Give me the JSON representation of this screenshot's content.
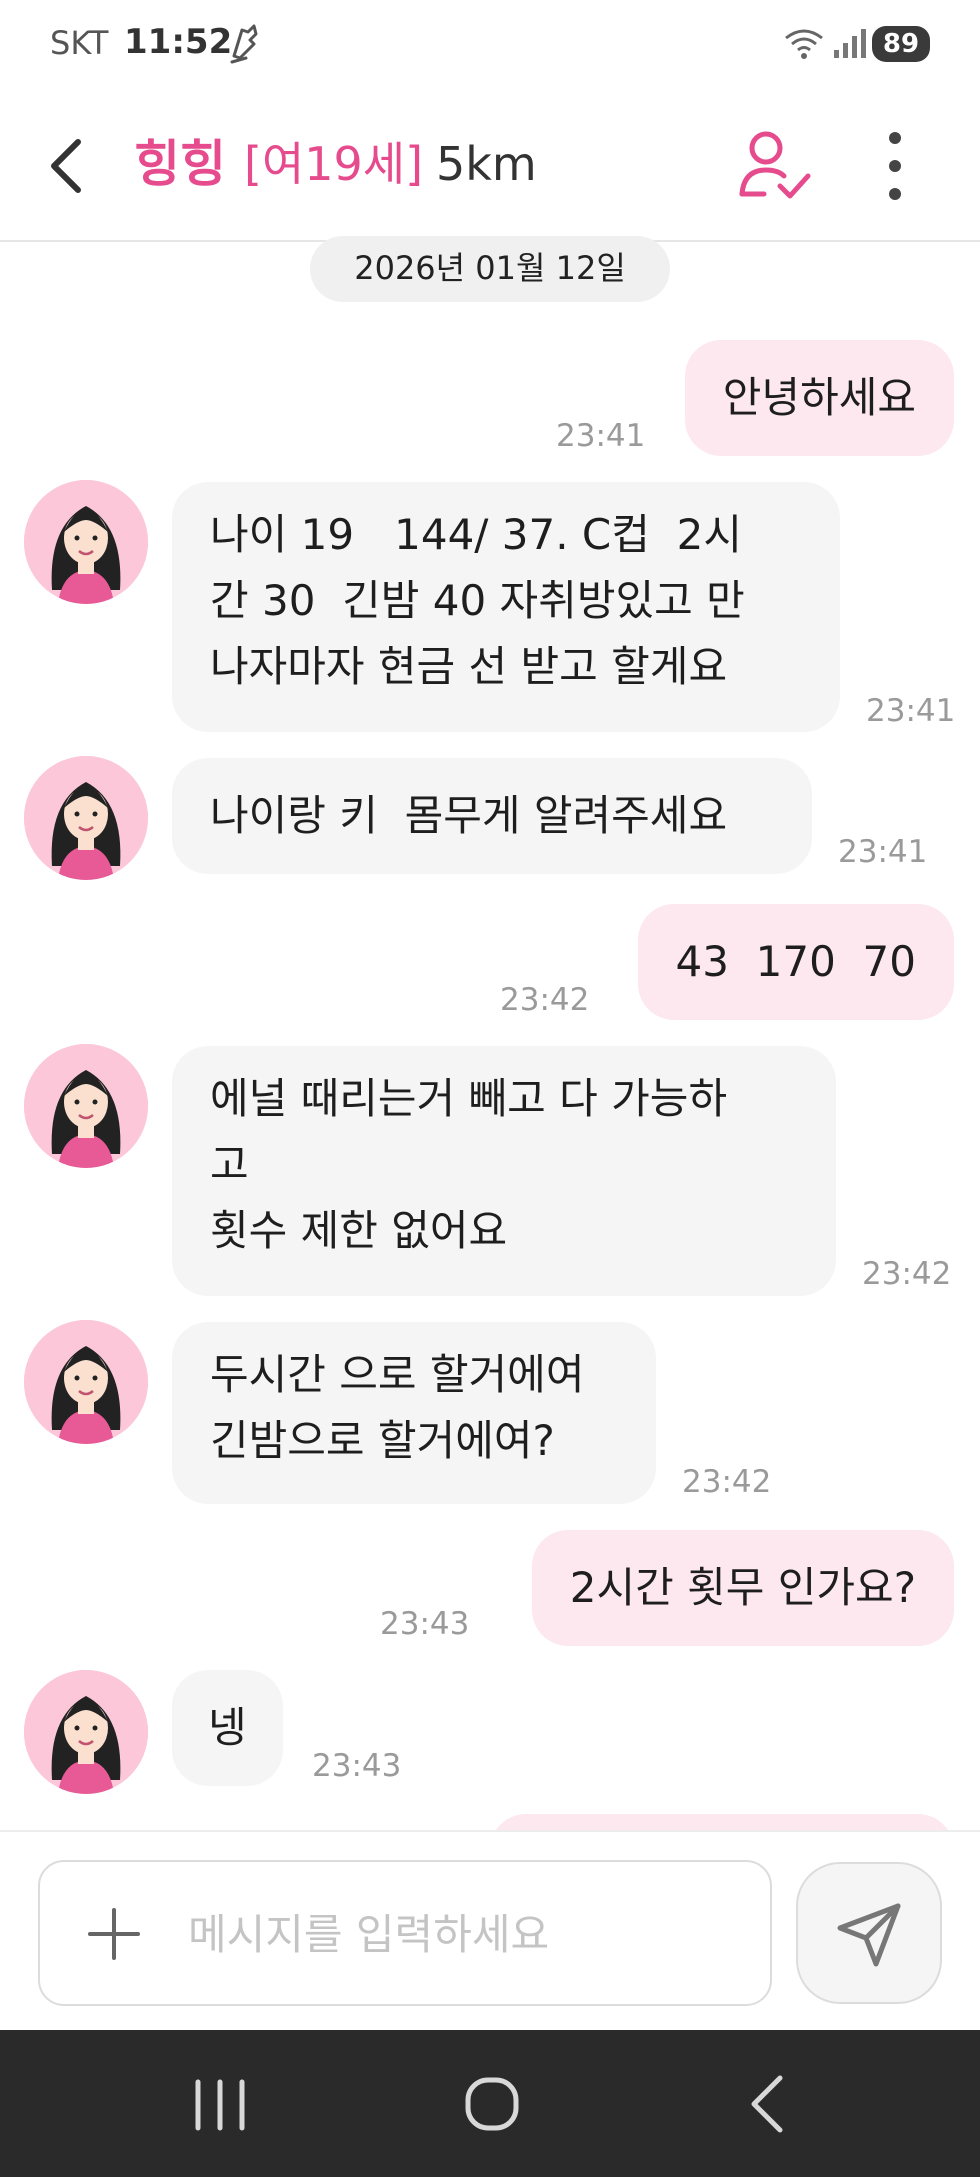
{
  "status_bar": {
    "carrier": "SKT",
    "time": "11:52",
    "battery": "89"
  },
  "header": {
    "name": "힝힝",
    "meta": "[여19세]",
    "distance": "5km"
  },
  "date_label": "2026년 01월 12일",
  "messages": [
    {
      "dir": "out",
      "text": "안녕하세요",
      "time": "23:41"
    },
    {
      "dir": "in",
      "text": "나이 19   144/ 37. C컵  2시\n간 30  긴밤 40 자취방있고 만\n나자마자 현금 선 받고 할게요",
      "time": "23:41"
    },
    {
      "dir": "in",
      "text": "나이랑 키  몸무게 알려주세요",
      "time": "23:41"
    },
    {
      "dir": "out",
      "text": "43  170  70",
      "time": "23:42"
    },
    {
      "dir": "in",
      "text": "에널 때리는거 빼고 다 가능하\n고\n횟수 제한 없어요",
      "time": "23:42"
    },
    {
      "dir": "in",
      "text": "두시간 으로 할거에여\n긴밤으로 할거에여?",
      "time": "23:42"
    },
    {
      "dir": "out",
      "text": "2시간 횟무 인가요?",
      "time": "23:43"
    },
    {
      "dir": "in",
      "text": "넹",
      "time": "23:43"
    }
  ],
  "composer": {
    "placeholder": "메시지를 입력하세요",
    "value": ""
  },
  "colors": {
    "accent": "#e54b8d",
    "outgoing_bubble": "#fde8ef",
    "incoming_bubble": "#f5f5f5",
    "avatar_bg": "#fcc7d9",
    "nav_bar": "#2a2a2a"
  },
  "icons": [
    "back-arrow-icon",
    "profile-check-icon",
    "more-vert-icon",
    "plus-icon",
    "send-icon",
    "recent-apps-icon",
    "home-icon",
    "nav-back-icon",
    "wifi-icon",
    "signal-icon"
  ]
}
